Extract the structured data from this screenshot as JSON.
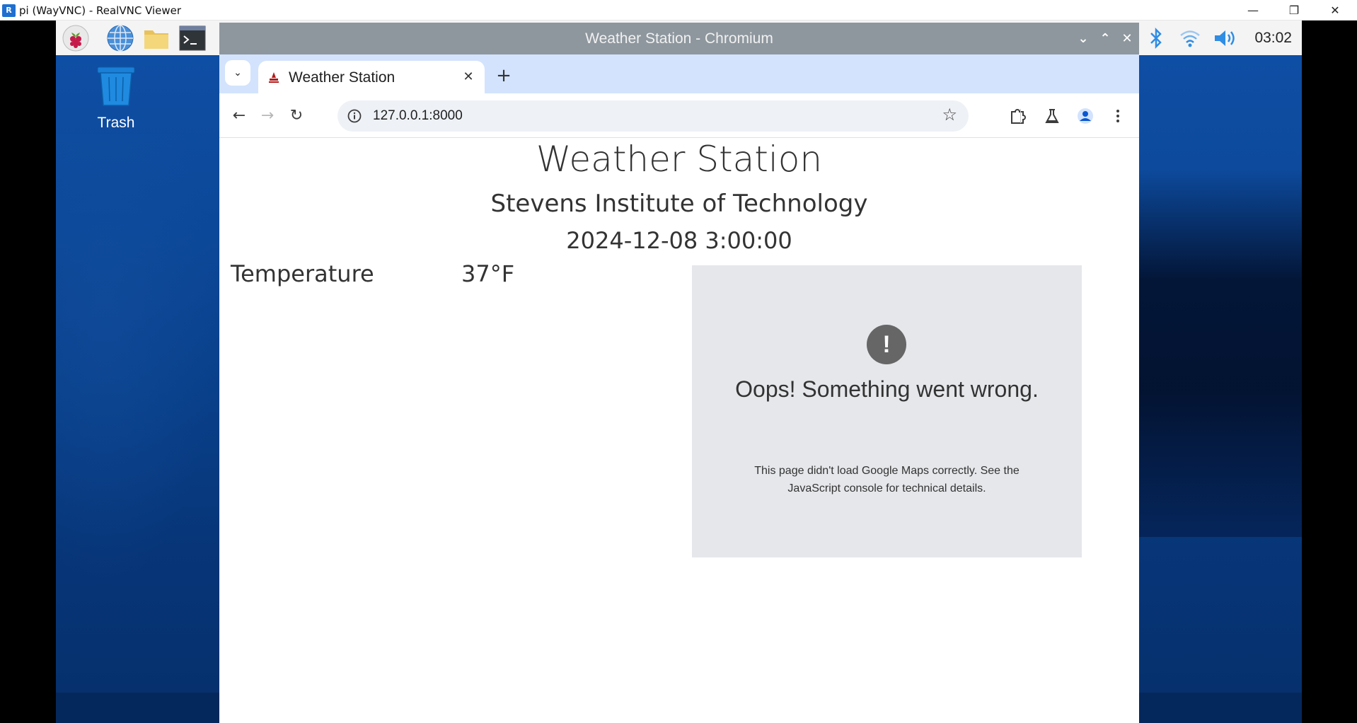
{
  "viewer": {
    "title": "pi (WayVNC) - RealVNC Viewer",
    "logo_text": "R",
    "controls": {
      "minimize": "—",
      "restore": "❐",
      "close": "✕"
    }
  },
  "desktop": {
    "taskbar": {
      "launchers": [
        "raspberry-icon",
        "web-browser-icon",
        "file-manager-icon",
        "terminal-icon"
      ],
      "tray": [
        "bluetooth-icon",
        "wifi-icon",
        "volume-icon"
      ],
      "clock": "03:02"
    },
    "trash_label": "Trash"
  },
  "browser": {
    "window_title": "Weather Station - Chromium",
    "window_controls": {
      "minimize": "⌄",
      "maximize": "⌃",
      "close": "✕"
    },
    "tab_search": "⌄",
    "tab": {
      "title": "Weather Station",
      "close": "✕"
    },
    "new_tab": "+",
    "nav": {
      "back": "←",
      "forward": "→",
      "reload": "↻"
    },
    "url": "127.0.0.1:8000",
    "star": "☆"
  },
  "page": {
    "title": "Weather Station",
    "subtitle": "Stevens Institute of Technology",
    "datetime": "2024-12-08 3:00:00",
    "temperature": {
      "label": "Temperature",
      "value": "37°F"
    },
    "map_error": {
      "icon": "!",
      "title": "Oops! Something went wrong.",
      "text": "This page didn't load Google Maps correctly. See the JavaScript console for technical details."
    }
  },
  "colors": {
    "desktop_bg": "#0c4899",
    "chromium_titlebar": "#8e979e",
    "tabstrip": "#d3e3fd",
    "map_placeholder": "#e5e7ea",
    "tray_blue": "#2f8de4"
  }
}
